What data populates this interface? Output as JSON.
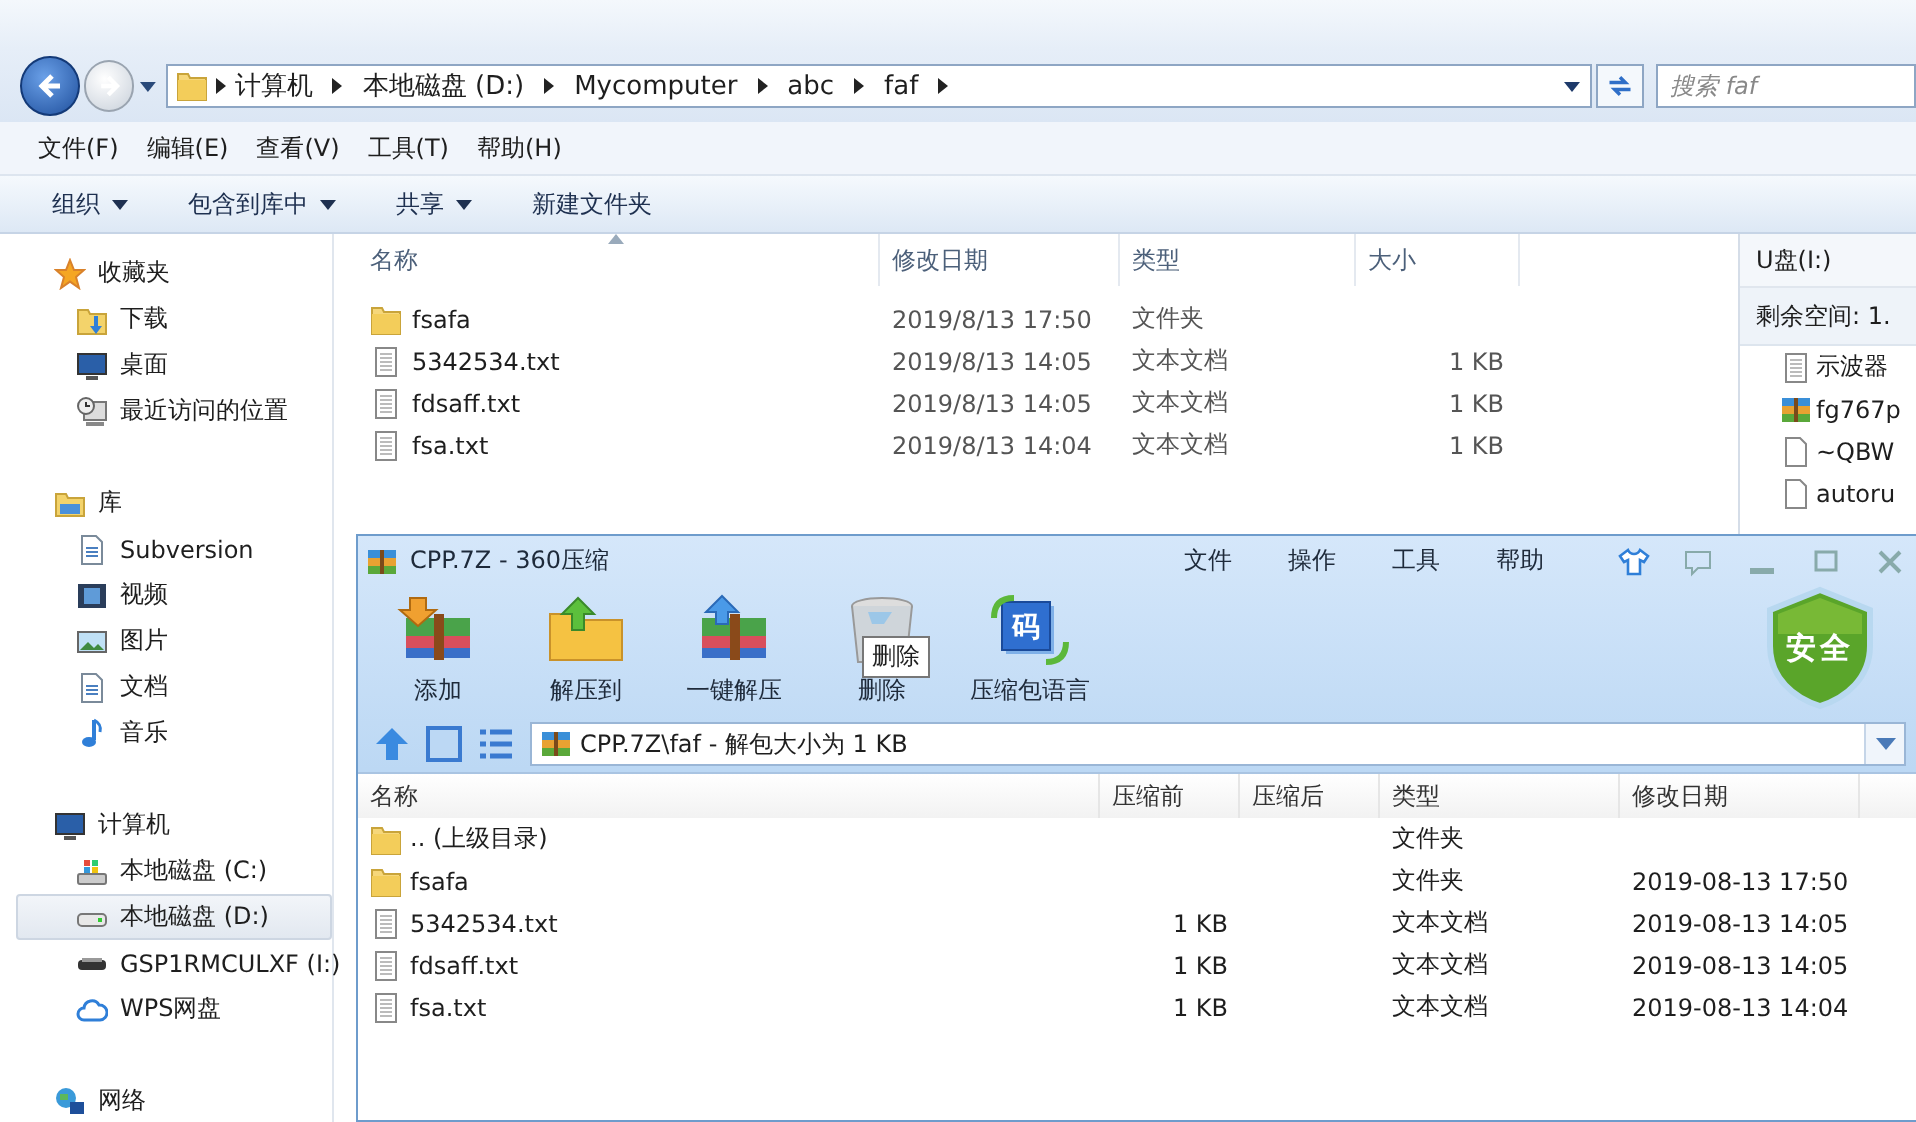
{
  "explorer": {
    "breadcrumb": [
      {
        "label": "计算机"
      },
      {
        "label": "本地磁盘 (D:)"
      },
      {
        "label": "Mycomputer"
      },
      {
        "label": "abc"
      },
      {
        "label": "faf"
      }
    ],
    "search": {
      "placeholder": "搜索 faf"
    },
    "menu": [
      "文件(F)",
      "编辑(E)",
      "查看(V)",
      "工具(T)",
      "帮助(H)"
    ],
    "toolbar": [
      {
        "label": "组织",
        "dropdown": true
      },
      {
        "label": "包含到库中",
        "dropdown": true
      },
      {
        "label": "共享",
        "dropdown": true
      },
      {
        "label": "新建文件夹",
        "dropdown": false
      }
    ],
    "sidebar": [
      {
        "label": "收藏夹",
        "kind": "star",
        "selected": false,
        "children": [
          {
            "label": "下载",
            "kind": "download",
            "selected": false
          },
          {
            "label": "桌面",
            "kind": "desktop",
            "selected": false
          },
          {
            "label": "最近访问的位置",
            "kind": "recent",
            "selected": false
          }
        ]
      },
      {
        "label": "库",
        "kind": "library",
        "selected": false,
        "children": [
          {
            "label": "Subversion",
            "kind": "subversion",
            "selected": false
          },
          {
            "label": "视频",
            "kind": "video",
            "selected": false
          },
          {
            "label": "图片",
            "kind": "picture",
            "selected": false
          },
          {
            "label": "文档",
            "kind": "document",
            "selected": false
          },
          {
            "label": "音乐",
            "kind": "music",
            "selected": false
          }
        ]
      },
      {
        "label": "计算机",
        "kind": "computer",
        "selected": false,
        "children": [
          {
            "label": "本地磁盘 (C:)",
            "kind": "system-drive",
            "selected": false
          },
          {
            "label": "本地磁盘 (D:)",
            "kind": "drive",
            "selected": true
          },
          {
            "label": "GSP1RMCULXF (I:)",
            "kind": "usb",
            "selected": false
          },
          {
            "label": "WPS网盘",
            "kind": "cloud",
            "selected": false
          }
        ]
      },
      {
        "label": "网络",
        "kind": "network",
        "selected": false
      }
    ],
    "columns": [
      "名称",
      "修改日期",
      "类型",
      "大小"
    ],
    "files": [
      {
        "kind": "folder",
        "name": "fsafa",
        "date": "2019/8/13 17:50",
        "type": "文件夹"
      },
      {
        "kind": "text",
        "name": "5342534.txt",
        "date": "2019/8/13 14:05",
        "type": "文本文档",
        "size": "1 KB"
      },
      {
        "kind": "text",
        "name": "fdsaff.txt",
        "date": "2019/8/13 14:05",
        "type": "文本文档",
        "size": "1 KB"
      },
      {
        "kind": "text",
        "name": "fsa.txt",
        "date": "2019/8/13 14:04",
        "type": "文本文档",
        "size": "1 KB"
      }
    ],
    "details": {
      "title": "U盘(I:)",
      "free_space": "剩余空间: 1.",
      "items": [
        {
          "kind": "text",
          "name": "示波器"
        },
        {
          "kind": "archive",
          "name": "fg767p"
        },
        {
          "kind": "file",
          "name": "~QBW"
        },
        {
          "kind": "file",
          "name": "autoru"
        }
      ]
    }
  },
  "archiver": {
    "title": "CPP.7Z - 360压缩",
    "menu": [
      "文件",
      "操作",
      "工具",
      "帮助"
    ],
    "tools": [
      {
        "label": "添加",
        "kind": "add"
      },
      {
        "label": "解压到",
        "kind": "extract"
      },
      {
        "label": "一键解压",
        "kind": "quick-extract"
      },
      {
        "label": "删除",
        "kind": "delete"
      },
      {
        "label": "压缩包语言",
        "kind": "language",
        "glyph": "码"
      }
    ],
    "tooltip": "删除",
    "badge": "安全",
    "path": "CPP.7Z\\faf - 解包大小为 1 KB",
    "columns": [
      "名称",
      "压缩前",
      "压缩后",
      "类型",
      "修改日期"
    ],
    "rows": [
      {
        "kind": "parent",
        "name": ".. (上级目录)",
        "type": "文件夹"
      },
      {
        "kind": "folder",
        "name": "fsafa",
        "type": "文件夹",
        "modified": "2019-08-13 17:50"
      },
      {
        "kind": "text",
        "name": "5342534.txt",
        "original_size": "1 KB",
        "type": "文本文档",
        "modified": "2019-08-13 14:05"
      },
      {
        "kind": "text",
        "name": "fdsaff.txt",
        "original_size": "1 KB",
        "type": "文本文档",
        "modified": "2019-08-13 14:05"
      },
      {
        "kind": "text",
        "name": "fsa.txt",
        "original_size": "1 KB",
        "type": "文本文档",
        "modified": "2019-08-13 14:04"
      }
    ]
  }
}
